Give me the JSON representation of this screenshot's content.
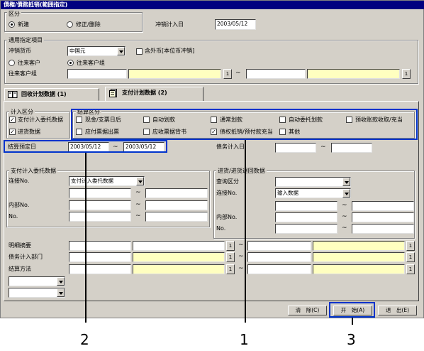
{
  "window": {
    "title": "債権/債務抵销(範囲指定)"
  },
  "kubun": {
    "label": "区分",
    "new_label": "新建",
    "edit_label": "修正/删除",
    "selected": "new"
  },
  "offset_date": {
    "label": "冲销计入日",
    "value": "2003/05/12"
  },
  "common": {
    "label": "通用指定項目",
    "currency_label": "冲销货币",
    "currency_value": "中国元",
    "include_foreign_label": "含外币[本位币冲销]",
    "include_foreign_checked": false,
    "radio_customer": "往来客户",
    "radio_customer_group": "往来客户组",
    "radio_selected": "customer_group",
    "customer_group_label": "往来客户组",
    "range_from_btn": "1",
    "range_to_btn": "1",
    "tilde": "~"
  },
  "tabs": [
    {
      "label": "回收计划数据 (1)",
      "active": false,
      "icon": "book-icon"
    },
    {
      "label": "支付计划数据 (2)",
      "active": true,
      "icon": "ledger-icon"
    }
  ],
  "booking_type": {
    "label": "计入区分",
    "items": [
      {
        "label": "支付计入委托数据",
        "checked": true
      },
      {
        "label": "进货数据",
        "checked": true
      }
    ]
  },
  "settlement_type": {
    "label": "结算区分",
    "items": [
      {
        "label": "现金/支票日后",
        "checked": false
      },
      {
        "label": "自动划款",
        "checked": false
      },
      {
        "label": "通常划款",
        "checked": false
      },
      {
        "label": "自动委托划款",
        "checked": false
      },
      {
        "label": "预收账款收取/充当",
        "checked": false
      },
      {
        "label": "应付票据出票",
        "checked": false
      },
      {
        "label": "应收票据背书",
        "checked": false
      },
      {
        "label": "债权抵销/预付款充当",
        "checked": true
      },
      {
        "label": "其他",
        "checked": false
      }
    ]
  },
  "due_date": {
    "label": "结算预定日",
    "from": "2003/05/12",
    "to": "2003/05/12",
    "tilde": "~"
  },
  "debt_booking_date": {
    "label": "债务计入日",
    "from": "",
    "to": "",
    "tilde": "~"
  },
  "payment_data": {
    "label": "支付计入委托数据",
    "link_label": "连接No.",
    "link_value": "支付计入委托数据",
    "internal_label": "内部No.",
    "no_label": "No.",
    "tilde": "~"
  },
  "purchase_data": {
    "label": "进货/进货退回数据",
    "query_label": "查询区分",
    "query_value": "",
    "link_label": "连接No.",
    "link_value": "输入数据",
    "internal_label": "内部No.",
    "no_label": "No.",
    "tilde": "~"
  },
  "detail": {
    "summary_label": "明细摘要",
    "dept_label": "债务计入部门",
    "method_label": "结算方法",
    "btn_label": "1",
    "tilde": "~"
  },
  "buttons": {
    "clear": "清　除(C)",
    "start": "开　始(A)",
    "exit": "退　出(E)"
  },
  "callouts": {
    "one": "1",
    "two": "2",
    "three": "3"
  },
  "colors": {
    "highlight": "#0033cc",
    "titlebar": "#000080",
    "field_yellow": "#ffffc0"
  }
}
